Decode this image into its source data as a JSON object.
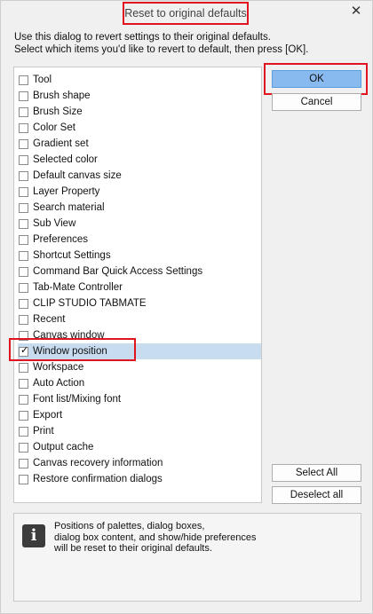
{
  "window": {
    "title": "Reset to original defaults",
    "close_glyph": "✕"
  },
  "intro": {
    "line1": "Use this dialog to revert settings to their original defaults.",
    "line2": "Select which items you'd like to revert to default, then press [OK]."
  },
  "items": [
    {
      "label": "Tool",
      "checked": false
    },
    {
      "label": "Brush shape",
      "checked": false
    },
    {
      "label": "Brush Size",
      "checked": false
    },
    {
      "label": "Color Set",
      "checked": false
    },
    {
      "label": "Gradient set",
      "checked": false
    },
    {
      "label": "Selected color",
      "checked": false
    },
    {
      "label": "Default canvas size",
      "checked": false
    },
    {
      "label": "Layer Property",
      "checked": false
    },
    {
      "label": "Search material",
      "checked": false
    },
    {
      "label": "Sub View",
      "checked": false
    },
    {
      "label": "Preferences",
      "checked": false
    },
    {
      "label": "Shortcut Settings",
      "checked": false
    },
    {
      "label": "Command Bar Quick Access Settings",
      "checked": false
    },
    {
      "label": "Tab-Mate Controller",
      "checked": false
    },
    {
      "label": "CLIP STUDIO TABMATE",
      "checked": false
    },
    {
      "label": "Recent",
      "checked": false
    },
    {
      "label": "Canvas window",
      "checked": false
    },
    {
      "label": "Window position",
      "checked": true,
      "selected": true
    },
    {
      "label": "Workspace",
      "checked": false
    },
    {
      "label": "Auto Action",
      "checked": false
    },
    {
      "label": "Font list/Mixing font",
      "checked": false
    },
    {
      "label": "Export",
      "checked": false
    },
    {
      "label": "Print",
      "checked": false
    },
    {
      "label": "Output cache",
      "checked": false
    },
    {
      "label": "Canvas recovery information",
      "checked": false
    },
    {
      "label": "Restore confirmation dialogs",
      "checked": false
    }
  ],
  "buttons": {
    "ok": "OK",
    "cancel": "Cancel",
    "select_all": "Select All",
    "deselect_all": "Deselect all"
  },
  "info": {
    "icon": "info-icon",
    "icon_glyph": "i",
    "line1": "Positions of palettes, dialog boxes,",
    "line2": "dialog box content, and show/hide preferences",
    "line3": "will be reset to their original defaults."
  },
  "colors": {
    "highlight": "#e0141e",
    "ok_button": "#88baf0",
    "selected_row": "#c8dcf0"
  }
}
